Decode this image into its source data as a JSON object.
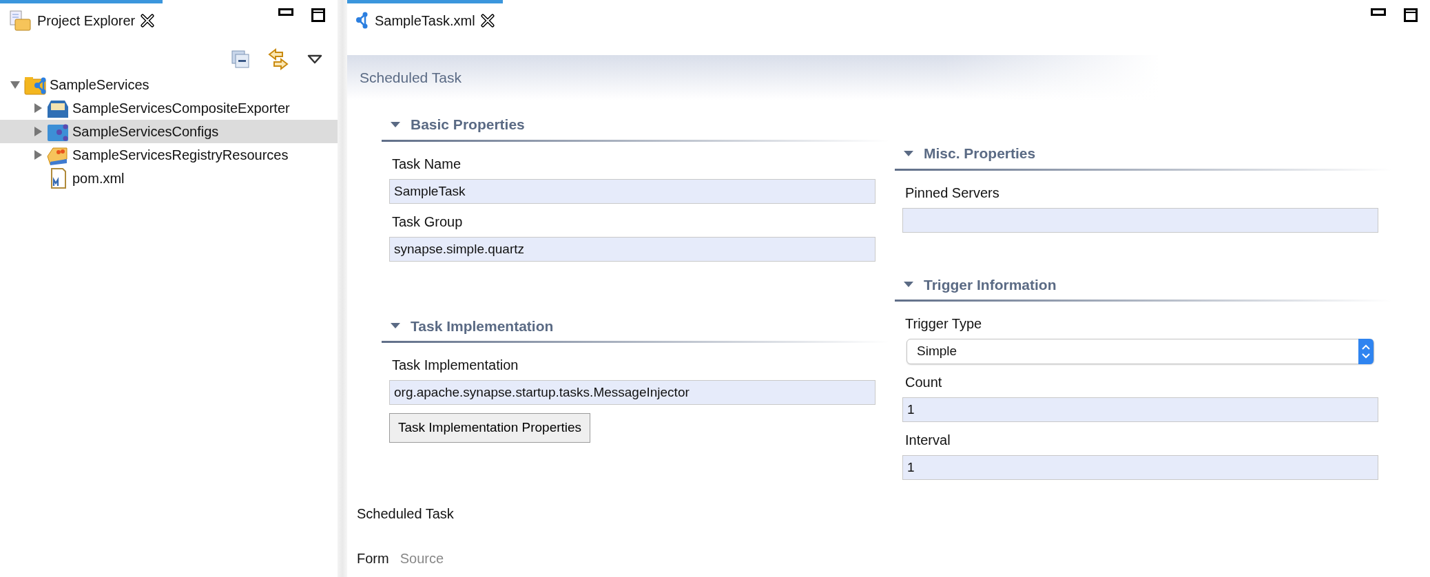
{
  "explorer": {
    "tab": {
      "title": "Project Explorer",
      "selected": true
    },
    "tree": [
      {
        "label": "SampleServices",
        "kind": "project",
        "expanded": true,
        "selected": false,
        "children": [
          {
            "label": "SampleServicesCompositeExporter",
            "kind": "exporter",
            "expanded": false,
            "selected": false
          },
          {
            "label": "SampleServicesConfigs",
            "kind": "configs",
            "expanded": false,
            "selected": true
          },
          {
            "label": "SampleServicesRegistryResources",
            "kind": "registry",
            "expanded": false,
            "selected": false
          },
          {
            "label": "pom.xml",
            "kind": "file",
            "selected": false
          }
        ]
      }
    ]
  },
  "editor": {
    "tab": {
      "title": "SampleTask.xml",
      "selected": true
    },
    "form_title": "Scheduled Task",
    "left_sections": [
      {
        "title": "Basic Properties",
        "expanded": true,
        "fields": [
          {
            "label": "Task Name",
            "kind": "text",
            "value": "SampleTask"
          },
          {
            "label": "Task Group",
            "kind": "text",
            "value": "synapse.simple.quartz"
          }
        ]
      },
      {
        "title": "Task Implementation",
        "expanded": true,
        "fields": [
          {
            "label": "Task Implementation",
            "kind": "text",
            "value": "org.apache.synapse.startup.tasks.MessageInjector"
          },
          {
            "kind": "button",
            "label": "Task Implementation Properties"
          }
        ]
      }
    ],
    "right_sections": [
      {
        "title": "Misc. Properties",
        "expanded": true,
        "fields": [
          {
            "label": "Pinned Servers",
            "kind": "text"
          }
        ]
      },
      {
        "title": "Trigger Information",
        "expanded": true,
        "fields": [
          {
            "label": "Trigger Type",
            "kind": "select",
            "value": "Simple"
          },
          {
            "label": "Count",
            "kind": "text",
            "value": "1"
          },
          {
            "label": "Interval",
            "kind": "text",
            "value": "1"
          }
        ]
      }
    ],
    "footer_title": "Scheduled Task",
    "page_tabs": [
      {
        "label": "Form",
        "selected": true
      },
      {
        "label": "Source",
        "selected": false
      }
    ]
  }
}
